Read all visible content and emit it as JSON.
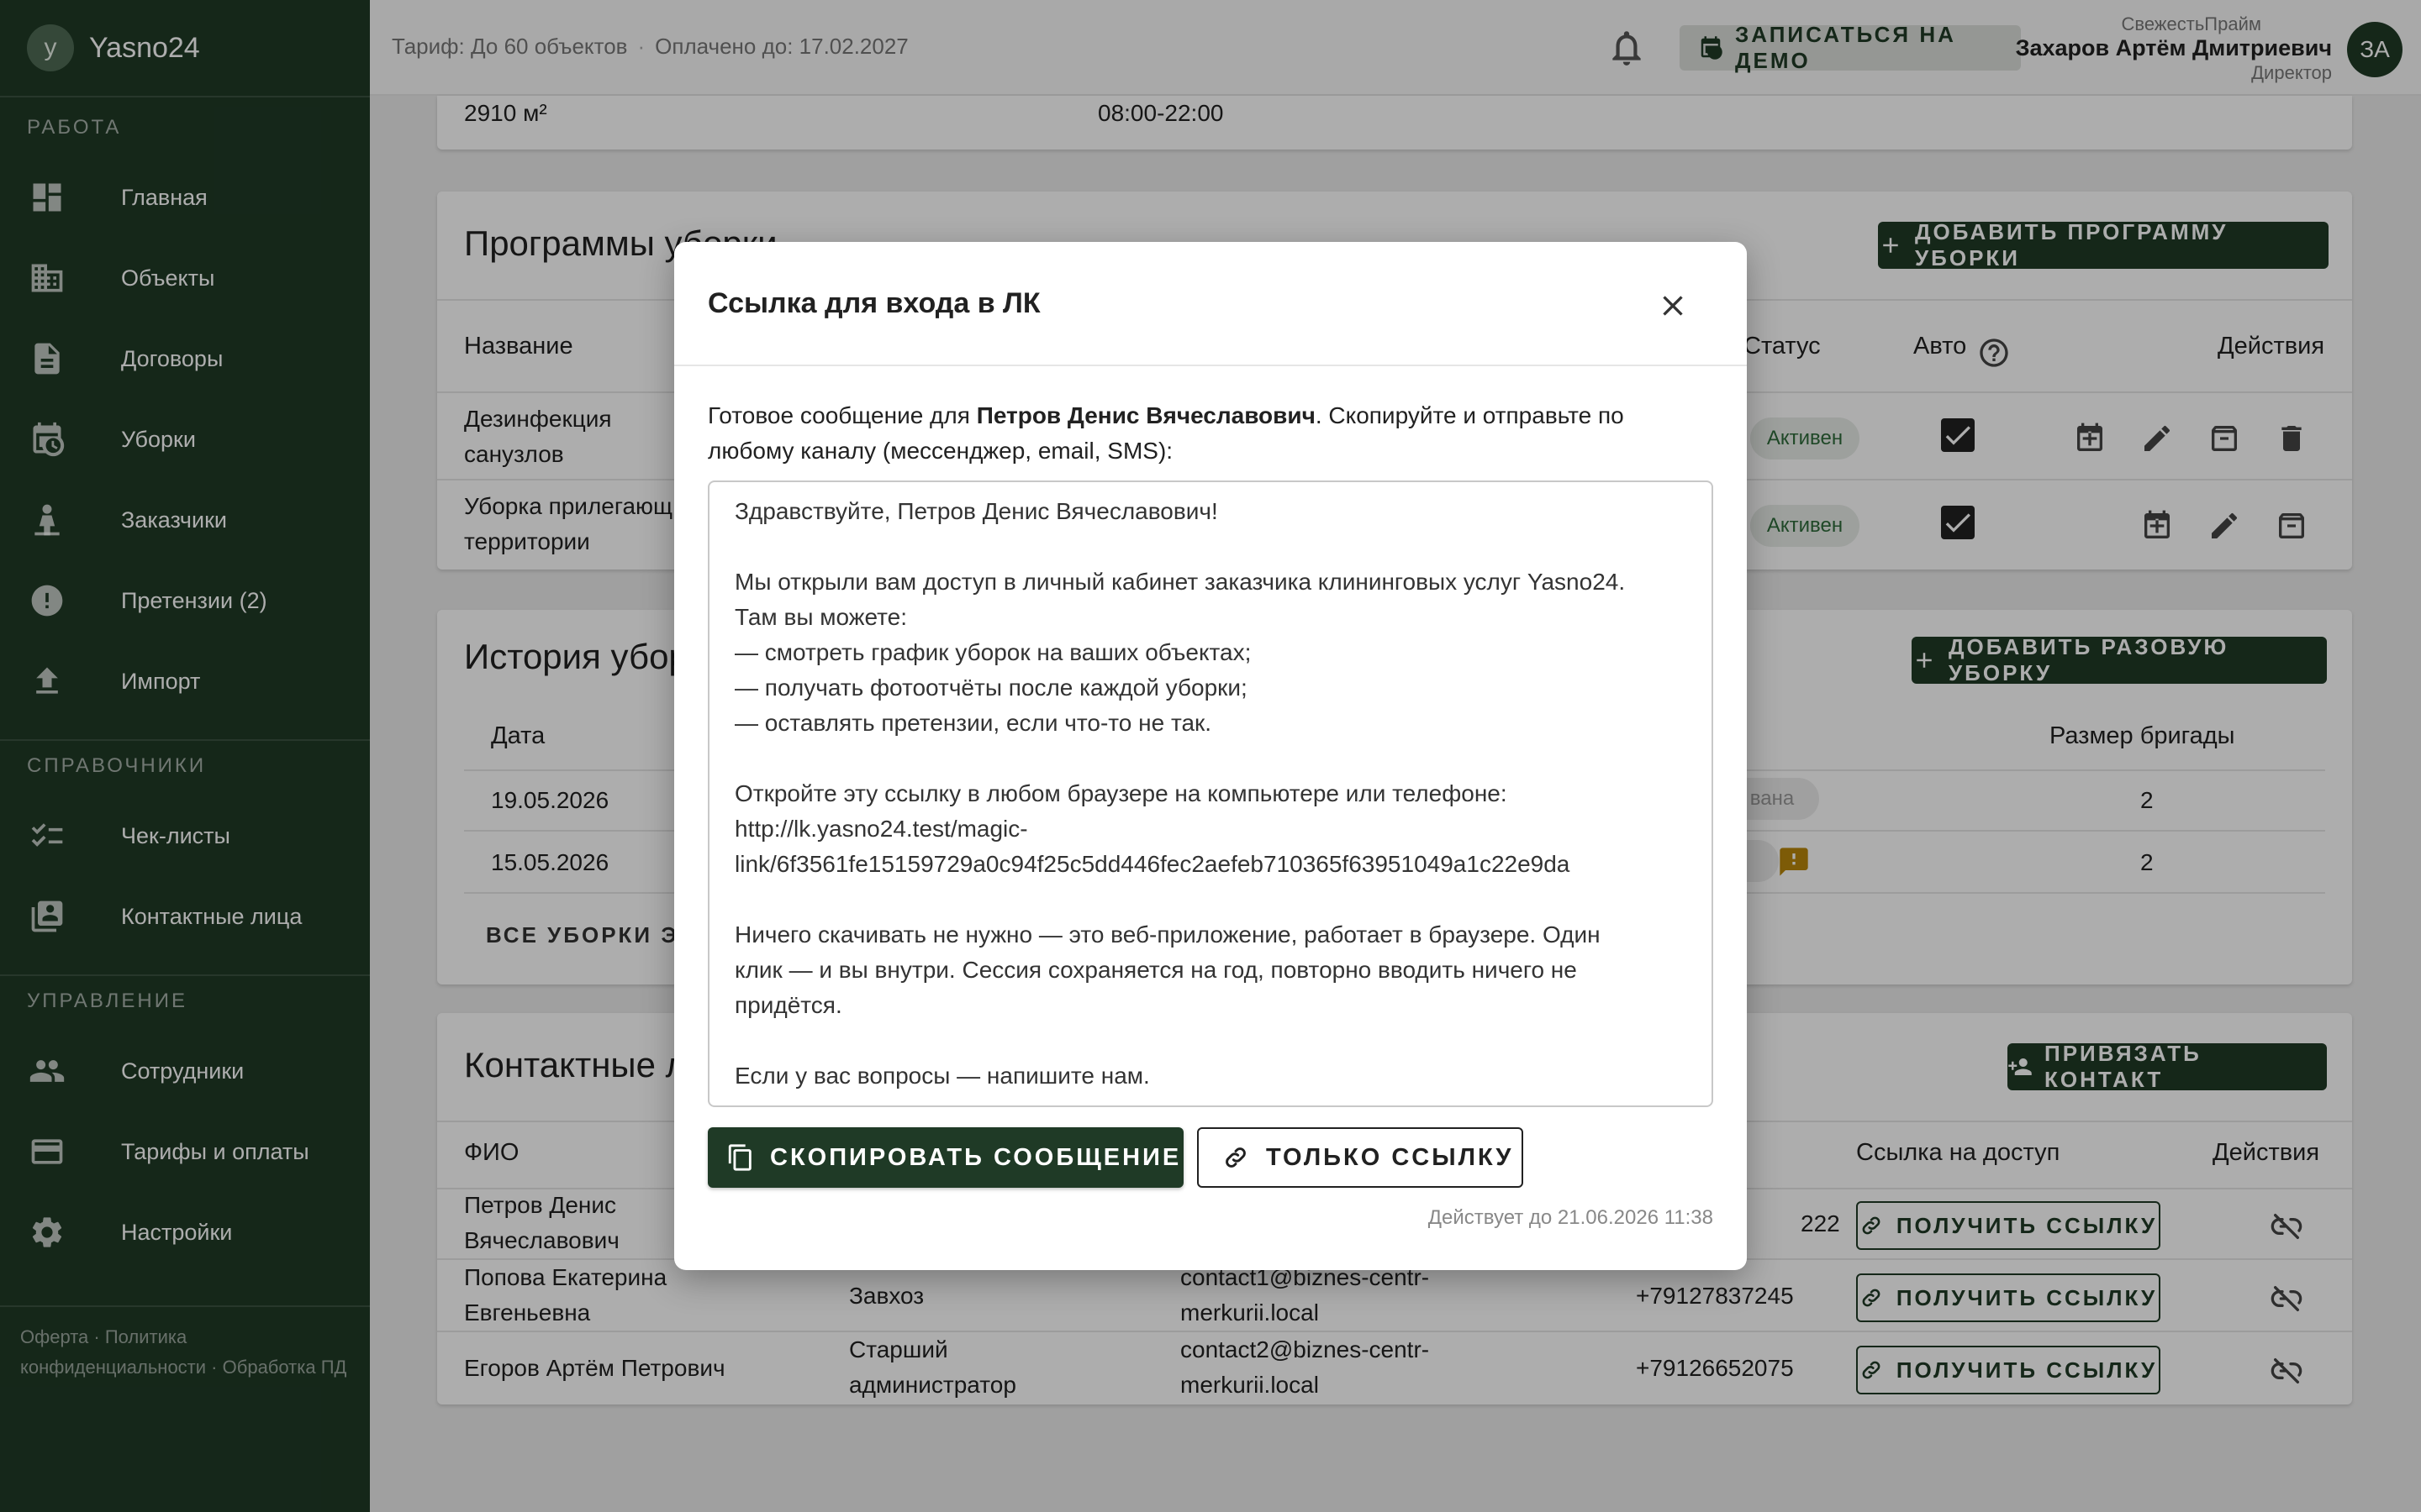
{
  "sidebar": {
    "brand_initial": "y",
    "brand_name": "Yasno24",
    "sections": {
      "work": "Работа",
      "references": "Справочники",
      "management": "Управление"
    },
    "items": [
      {
        "label": "Главная",
        "icon": "dashboard-icon"
      },
      {
        "label": "Объекты",
        "icon": "building-icon"
      },
      {
        "label": "Договоры",
        "icon": "document-icon"
      },
      {
        "label": "Уборки",
        "icon": "calendar-clock-icon"
      },
      {
        "label": "Заказчики",
        "icon": "customer-icon"
      },
      {
        "label": "Претензии (2)",
        "icon": "alert-icon"
      },
      {
        "label": "Импорт",
        "icon": "upload-icon"
      },
      {
        "label": "Чек-листы",
        "icon": "checklist-icon"
      },
      {
        "label": "Контактные лица",
        "icon": "contacts-icon"
      },
      {
        "label": "Сотрудники",
        "icon": "people-icon"
      },
      {
        "label": "Тарифы и оплаты",
        "icon": "credit-card-icon"
      },
      {
        "label": "Настройки",
        "icon": "gear-icon"
      }
    ],
    "footer": {
      "offer": "Оферта",
      "privacy": "Политика конфиденциальности",
      "pd": "Обработка ПД",
      "sep": "·"
    }
  },
  "topbar": {
    "tariff": "Тариф: До 60 объектов",
    "sep": "·",
    "paid": "Оплачено до: 17.02.2027",
    "demo_button": "ЗАПИСАТЬСЯ НА ДЕМО",
    "company": "СвежестьПрайм",
    "user": "Захаров Артём Дмитриевич",
    "role": "Директор",
    "avatar": "ЗА"
  },
  "object_info": {
    "area": "2910 м²",
    "hours": "08:00-22:00"
  },
  "programs": {
    "title": "Программы уборки",
    "add_button": "ДОБАВИТЬ ПРОГРАММУ УБОРКИ",
    "headers": {
      "name": "Название",
      "status": "Статус",
      "auto": "Авто",
      "actions": "Действия"
    },
    "rows": [
      {
        "name_1": "Дезинфекция",
        "name_2": "санузлов",
        "status": "Активен"
      },
      {
        "name_1": "Уборка прилегающ",
        "name_2": "территории",
        "status": "Активен"
      }
    ]
  },
  "history": {
    "title": "История убор",
    "add_button": "ДОБАВИТЬ РАЗОВУЮ УБОРКУ",
    "headers": {
      "date": "Дата",
      "team": "Размер бригады"
    },
    "rows": [
      {
        "date": "19.05.2026",
        "status": "вана",
        "team": "2"
      },
      {
        "date": "15.05.2026",
        "team": "2"
      }
    ],
    "all_link": "ВСЕ УБОРКИ ЭТ"
  },
  "contacts": {
    "title": "Контактные л",
    "bind_button": "ПРИВЯЗАТЬ КОНТАКТ",
    "headers": {
      "fio": "ФИО",
      "link": "Ссылка на доступ",
      "actions": "Действия"
    },
    "get_link": "ПОЛУЧИТЬ ССЫЛКУ",
    "rows": [
      {
        "fio_1": "Петров Денис",
        "fio_2": "Вячеславович",
        "role_1": "",
        "role_2": "",
        "email_1": "",
        "email_2": "",
        "phone": "222"
      },
      {
        "fio_1": "Попова Екатерина",
        "fio_2": "Евгеньевна",
        "role_1": "Завхоз",
        "role_2": "",
        "email_1": "contact1@biznes-centr-",
        "email_2": "merkurii.local",
        "phone": "+79127837245"
      },
      {
        "fio_1": "Егоров Артём Петрович",
        "fio_2": "",
        "role_1": "Старший",
        "role_2": "администратор",
        "email_1": "contact2@biznes-centr-",
        "email_2": "merkurii.local",
        "phone": "+79126652075"
      }
    ]
  },
  "modal": {
    "title": "Ссылка для входа в ЛК",
    "intro_prefix": "Готовое сообщение для ",
    "intro_name": "Петров Денис Вячеславович",
    "intro_suffix_1": ". Скопируйте и отправьте по",
    "intro_suffix_2": "любому каналу (мессенджер, email, SMS):",
    "message_lines": [
      "Здравствуйте, Петров Денис Вячеславович!",
      "",
      "Мы открыли вам доступ в личный кабинет заказчика клининговых услуг Yasno24.",
      "Там вы можете:",
      "— смотреть график уборок на ваших объектах;",
      "— получать фотоотчёты после каждой уборки;",
      "— оставлять претензии, если что-то не так.",
      "",
      "Откройте эту ссылку в любом браузере на компьютере или телефоне:",
      "http://lk.yasno24.test/magic-",
      "link/6f3561fe15159729a0c94f25c5dd446fec2aefeb710365f63951049a1c22e9da",
      "",
      "Ничего скачивать не нужно — это веб-приложение, работает в браузере. Один",
      "клик — и вы внутри. Сессия сохраняется на год, повторно вводить ничего не",
      "придётся.",
      "",
      "Если у вас вопросы — напишите нам."
    ],
    "copy_button": "СКОПИРОВАТЬ СООБЩЕНИЕ",
    "link_only_button": "ТОЛЬКО ССЫЛКУ",
    "valid_until": "Действует до 21.06.2026 11:38"
  },
  "colors": {
    "sidebar": "#1f3a26",
    "accent": "#1f3a26",
    "chip_bg": "#e8ece8",
    "warning": "#b8860b"
  }
}
